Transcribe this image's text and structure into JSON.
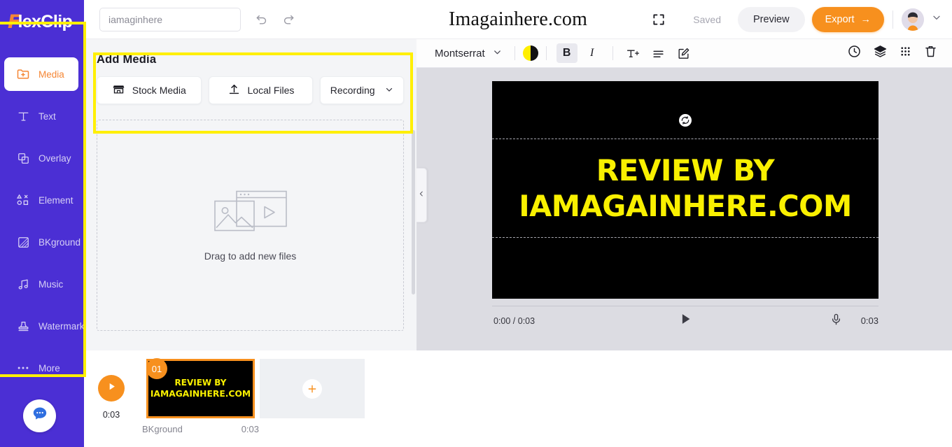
{
  "brand": {
    "logo_first": "F",
    "logo_rest": "lexClip",
    "accent_orange": "#f7901e",
    "sidebar_purple": "#4b2fd4",
    "highlight_yellow": "#ffef00",
    "canvas_text_yellow": "#f9f000"
  },
  "sidebar": {
    "items": [
      {
        "label": "Media",
        "icon": "folder-plus-icon",
        "active": true
      },
      {
        "label": "Text",
        "icon": "text-icon",
        "active": false
      },
      {
        "label": "Overlay",
        "icon": "overlay-icon",
        "active": false
      },
      {
        "label": "Element",
        "icon": "element-icon",
        "active": false
      },
      {
        "label": "BKground",
        "icon": "background-icon",
        "active": false
      },
      {
        "label": "Music",
        "icon": "music-note-icon",
        "active": false
      },
      {
        "label": "Watermark",
        "icon": "watermark-icon",
        "active": false
      },
      {
        "label": "More",
        "icon": "ellipsis-icon",
        "active": false
      }
    ],
    "chat_icon": "chat-bubble-icon"
  },
  "topbar": {
    "project_name_value": "iamaginhere",
    "project_name_placeholder": "iamaginhere",
    "undo_icon": "undo-icon",
    "redo_icon": "redo-icon",
    "title": "Imagainhere.com",
    "fullscreen_icon": "fullscreen-icon",
    "saved_label": "Saved",
    "preview_label": "Preview",
    "export_label": "Export",
    "export_arrow": "→",
    "avatar_icon": "user-avatar",
    "account_caret_icon": "chevron-down-icon"
  },
  "editor_toolbar": {
    "font_family": "Montserrat",
    "font_caret_icon": "chevron-down-icon",
    "color_swatch_icon": "text-color-swatch",
    "bold_label": "B",
    "italic_label": "I",
    "font_size_icon": "font-size-icon",
    "align_icon": "align-left-icon",
    "edit_icon": "edit-text-icon",
    "right_icons": [
      {
        "name": "clock-icon"
      },
      {
        "name": "layers-icon"
      },
      {
        "name": "grid-apps-icon"
      },
      {
        "name": "trash-icon"
      }
    ]
  },
  "media_panel": {
    "heading": "Add Media",
    "buttons": [
      {
        "label": "Stock Media",
        "icon": "stock-media-icon"
      },
      {
        "label": "Local Files",
        "icon": "upload-icon"
      },
      {
        "label": "Recording",
        "icon": "chevron-down-icon"
      }
    ],
    "dropzone_text": "Drag to add new files",
    "dropzone_icon": "image-video-placeholder-icon",
    "collapse_icon": "chevron-left-icon"
  },
  "canvas": {
    "rotate_icon": "rotate-refresh-icon",
    "text_line1": "REVIEW BY",
    "text_line2": "IAMAGAINHERE.COM",
    "background_color": "#000000"
  },
  "player": {
    "current_and_total": "0:00 / 0:03",
    "play_icon": "play-icon",
    "mic_icon": "microphone-icon",
    "duration": "0:03"
  },
  "timeline": {
    "play_icon": "play-icon",
    "play_time": "0:03",
    "clip": {
      "badge": "01",
      "text_line1": "REVIEW BY",
      "text_line2": "IAMAGAINHERE.COM",
      "name": "BKground",
      "duration": "0:03"
    },
    "add_label": "+",
    "add_icon": "plus-icon"
  }
}
